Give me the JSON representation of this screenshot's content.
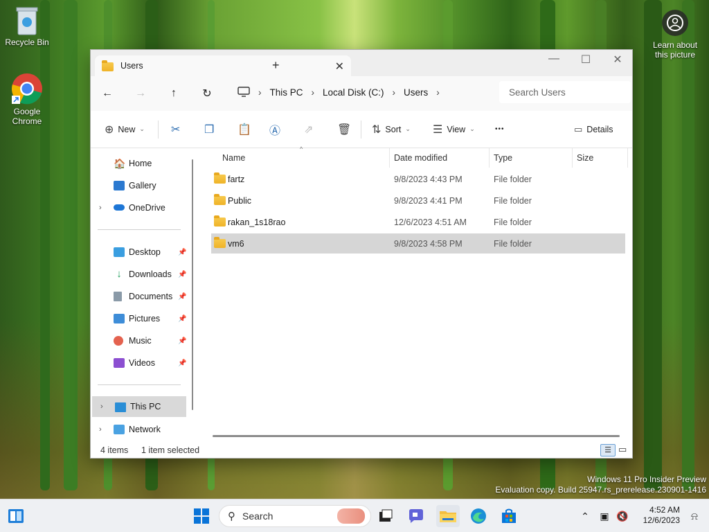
{
  "desktop": {
    "recycle_bin": "Recycle Bin",
    "chrome_line1": "Google",
    "chrome_line2": "Chrome",
    "learn_line1": "Learn about",
    "learn_line2": "this picture"
  },
  "window": {
    "tab_title": "Users",
    "new_tab": "+",
    "close_tab": "✕"
  },
  "address": {
    "crumbs": [
      "This PC",
      "Local Disk (C:)",
      "Users"
    ],
    "search_placeholder": "Search Users"
  },
  "commandbar": {
    "new_label": "New",
    "sort_label": "Sort",
    "view_label": "View",
    "more_label": "•••",
    "details_label": "Details"
  },
  "sidebar": {
    "home": "Home",
    "gallery": "Gallery",
    "onedrive": "OneDrive",
    "desktop": "Desktop",
    "downloads": "Downloads",
    "documents": "Documents",
    "pictures": "Pictures",
    "music": "Music",
    "videos": "Videos",
    "this_pc": "This PC",
    "network": "Network"
  },
  "columns": {
    "name": "Name",
    "date": "Date modified",
    "type": "Type",
    "size": "Size"
  },
  "files": [
    {
      "name": "fartz",
      "date": "9/8/2023 4:43 PM",
      "type": "File folder"
    },
    {
      "name": "Public",
      "date": "9/8/2023 4:41 PM",
      "type": "File folder"
    },
    {
      "name": "rakan_1s18rao",
      "date": "12/6/2023 4:51 AM",
      "type": "File folder"
    },
    {
      "name": "vm6",
      "date": "9/8/2023 4:58 PM",
      "type": "File folder"
    }
  ],
  "status": {
    "count": "4 items",
    "selected": "1 item selected"
  },
  "watermark": {
    "line1": "Windows 11 Pro Insider Preview",
    "line2": "Evaluation copy. Build 25947.rs_prerelease.230901-1416"
  },
  "taskbar": {
    "search_label": "Search",
    "time": "4:52 AM",
    "date": "12/6/2023"
  }
}
